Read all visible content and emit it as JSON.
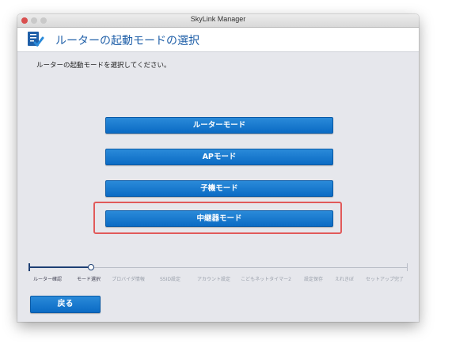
{
  "window": {
    "title": "SkyLink Manager"
  },
  "header": {
    "title": "ルーターの起動モードの選択",
    "icon": "checklist-icon"
  },
  "instruction": "ルーターの起動モードを選択してください。",
  "modes": [
    {
      "label": "ルーターモード"
    },
    {
      "label": "APモード"
    },
    {
      "label": "子機モード"
    },
    {
      "label": "中継器モード",
      "highlighted": true
    }
  ],
  "steps": [
    {
      "label": "ルーター確認",
      "state": "done"
    },
    {
      "label": "モード選択",
      "state": "current"
    },
    {
      "label": "プロバイダ情報",
      "state": "todo"
    },
    {
      "label": "SSID設定",
      "state": "todo"
    },
    {
      "label": "アカウント設定",
      "state": "todo"
    },
    {
      "label": "こどもネットタイマー2",
      "state": "todo"
    },
    {
      "label": "設定保存",
      "state": "todo"
    },
    {
      "label": "えれきぼ",
      "state": "todo"
    },
    {
      "label": "セットアップ完了",
      "state": "todo"
    }
  ],
  "back_button": "戻る",
  "colors": {
    "accent": "#0b6bc4",
    "highlight": "#e15a5a",
    "title_blue": "#1f5fa8"
  }
}
